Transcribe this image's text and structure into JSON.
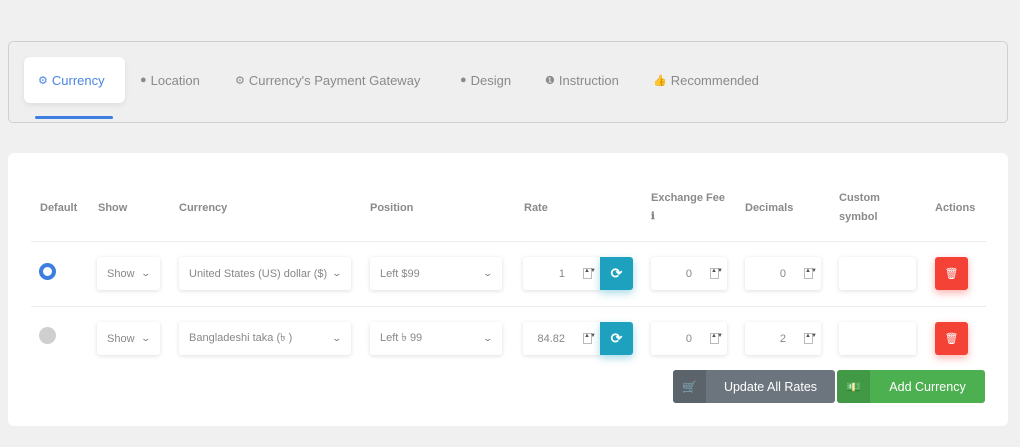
{
  "tabs": [
    {
      "label": "Currency",
      "icon": "gear-icon",
      "active": true
    },
    {
      "label": "Location",
      "icon": "globe-icon"
    },
    {
      "label": "Currency's Payment Gateway",
      "icon": "gear-icon"
    },
    {
      "label": "Design",
      "icon": "globe-icon"
    },
    {
      "label": "Instruction",
      "icon": "info-icon"
    },
    {
      "label": "Recommended",
      "icon": "thumbs-up-icon"
    }
  ],
  "table": {
    "headers": {
      "default": "Default",
      "show": "Show",
      "currency": "Currency",
      "position": "Position",
      "rate": "Rate",
      "fee_line1": "Exchange Fee",
      "decimals": "Decimals",
      "custom_line1": "Custom",
      "custom_line2": "symbol",
      "actions": "Actions"
    },
    "rows": [
      {
        "default": true,
        "show": "Show",
        "currency": "United States (US) dollar ($)",
        "position": "Left $99",
        "rate": "1",
        "fee": "0",
        "decimals": "0",
        "custom_symbol": ""
      },
      {
        "default": false,
        "show": "Show",
        "currency": "Bangladeshi taka (৳ )",
        "position": "Left ৳ 99",
        "rate": "84.82",
        "fee": "0",
        "decimals": "2",
        "custom_symbol": ""
      }
    ]
  },
  "buttons": {
    "update_all": "Update All Rates",
    "add_currency": "Add Currency"
  },
  "colors": {
    "accent": "#3d7fe0",
    "refresh": "#1da1bf",
    "delete": "#f44336",
    "update": "#6c757d",
    "add": "#4caf50"
  }
}
